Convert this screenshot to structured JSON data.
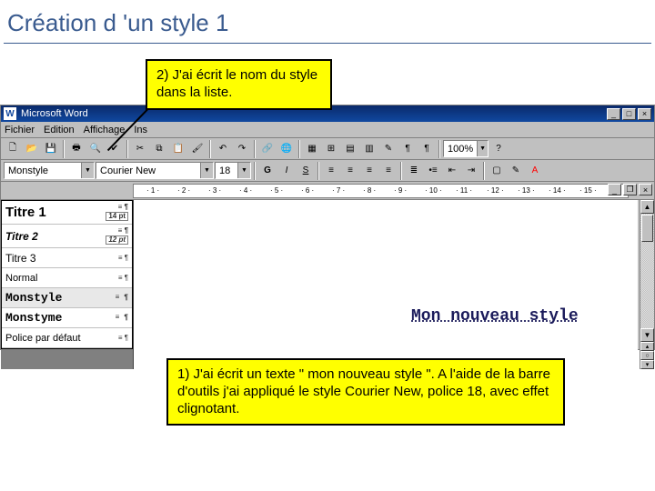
{
  "slide": {
    "title": "Création d 'un style 1"
  },
  "callouts": {
    "top": "2) J'ai écrit le nom du style dans la liste.",
    "bottom": "1) J'ai écrit un texte \" mon nouveau style \". A l'aide de la barre d'outils j'ai appliqué le style Courier New, police 18, avec effet clignotant."
  },
  "word": {
    "app_title": "Microsoft Word",
    "menus": [
      "Fichier",
      "Edition",
      "Affichage",
      "Ins"
    ],
    "style_value": "Monstyle",
    "font_value": "Courier New",
    "size_value": "18",
    "zoom_value": "100%",
    "ruler_ticks": [
      "1",
      "2",
      "3",
      "4",
      "5",
      "6",
      "7",
      "8",
      "9",
      "10",
      "11",
      "12",
      "13",
      "14",
      "15"
    ],
    "doc_text": "Mon nouveau style",
    "dropdown": [
      {
        "label": "Titre 1",
        "cls": "t1",
        "size": "14 pt"
      },
      {
        "label": "Titre 2",
        "cls": "t2",
        "size": "12 pt"
      },
      {
        "label": "Titre 3",
        "cls": "t3",
        "size": ""
      },
      {
        "label": "Normal",
        "cls": "norm",
        "size": ""
      },
      {
        "label": "Monstyle",
        "cls": "mono sel",
        "size": ""
      },
      {
        "label": "Monstyme",
        "cls": "mono",
        "size": ""
      },
      {
        "label": "Police par défaut",
        "cls": "pdf",
        "size": ""
      }
    ]
  }
}
